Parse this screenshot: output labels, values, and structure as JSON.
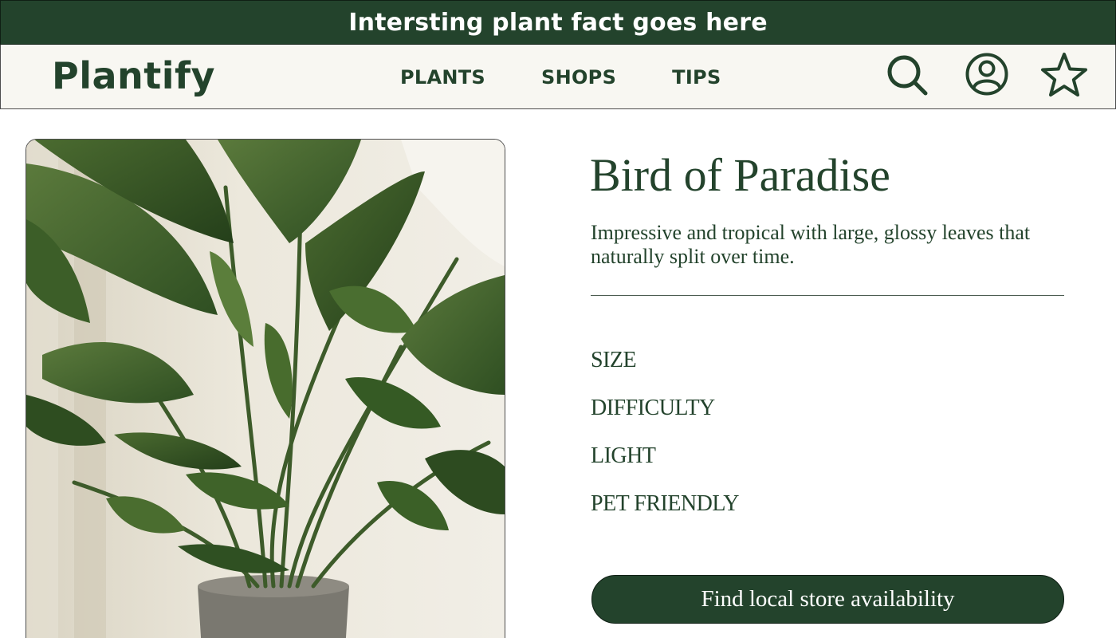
{
  "banner": {
    "text": "Intersting plant fact goes here"
  },
  "nav": {
    "brand": "Plantify",
    "links": [
      "PLANTS",
      "SHOPS",
      "TIPS"
    ],
    "icons": [
      "search-icon",
      "account-icon",
      "star-icon"
    ]
  },
  "product": {
    "image_icon": "plant-photo",
    "name": "Bird of Paradise",
    "description": "Impressive and tropical with large, glossy leaves that naturally split over time.",
    "attributes": [
      "SIZE",
      "DIFFICULTY",
      "LIGHT",
      "PET FRIENDLY"
    ],
    "cta_label": "Find local store availability"
  },
  "colors": {
    "brand_green": "#23432c",
    "nav_background": "#f8f7f2",
    "text_on_green": "#ffffff"
  }
}
